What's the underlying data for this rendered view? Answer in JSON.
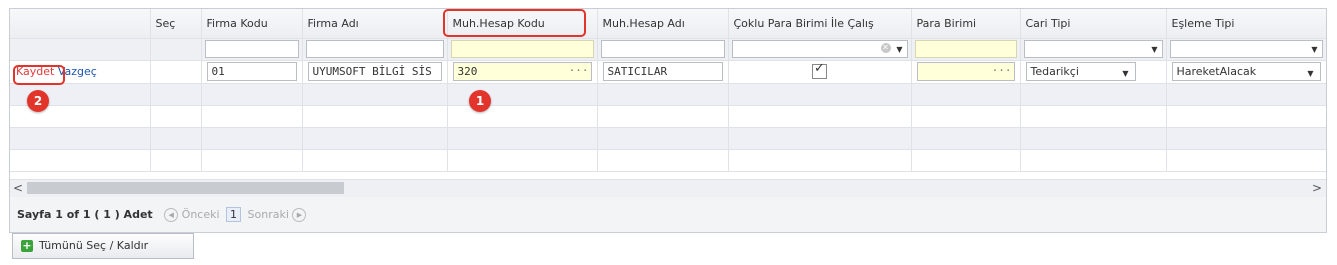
{
  "columns": [
    "",
    "Seç",
    "Firma Kodu",
    "Firma Adı",
    "Muh.Hesap Kodu",
    "Muh.Hesap Adı",
    "Çoklu Para Birimi İle Çalış",
    "Para Birimi",
    "Cari Tipi",
    "Eşleme Tipi"
  ],
  "row": {
    "save_label": "Kaydet",
    "cancel_label": "Vazgeç",
    "firma_kodu": "01",
    "firma_adi": "UYUMSOFT BİLGİ SİS",
    "muh_hesap_kodu": "320",
    "muh_hesap_adi": "SATICILAR",
    "coklu_para": true,
    "para_birimi": "",
    "cari_tipi": "Tedarikçi",
    "esleme_tipi": "HareketAlacak"
  },
  "badges": [
    "1",
    "2"
  ],
  "pager": {
    "summary": "Sayfa 1 of 1 ( 1 ) Adet",
    "prev": "Önceki",
    "page": "1",
    "next": "Sonraki"
  },
  "select_all_button": "Tümünü Seç / Kaldır",
  "colors": {
    "highlight": "#e2342b",
    "link": "#1a55b0",
    "filter_yellow": "#ffffd9"
  }
}
